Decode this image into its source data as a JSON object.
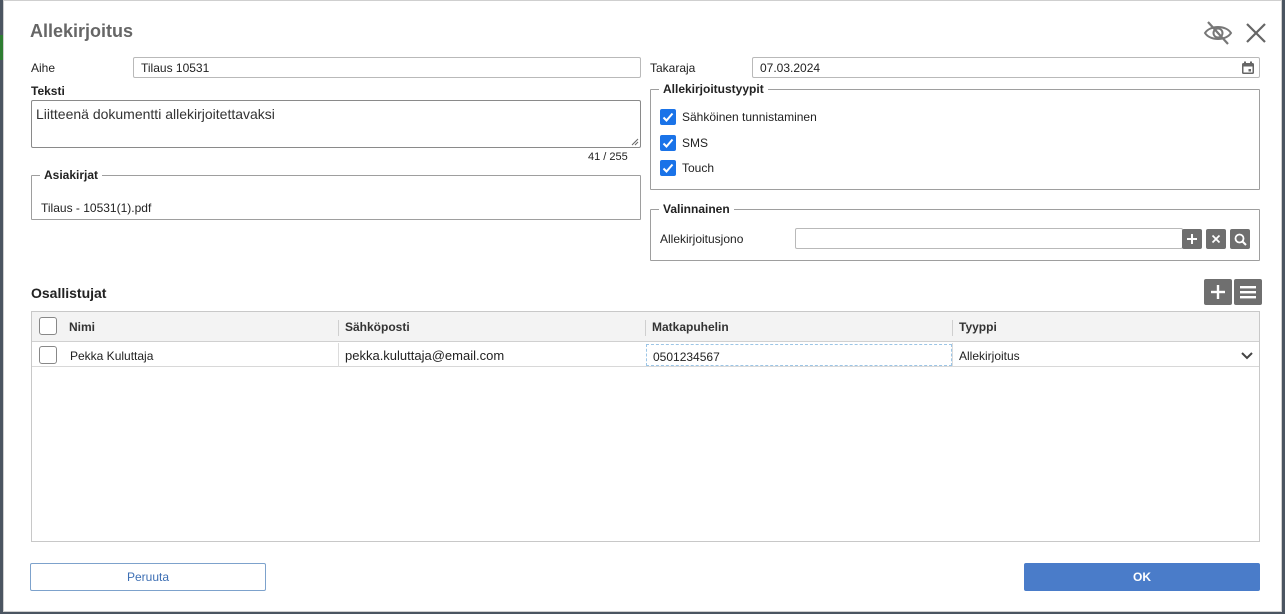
{
  "dialog": {
    "title": "Allekirjoitus"
  },
  "fields": {
    "subject_label": "Aihe",
    "subject_value": "Tilaus 10531",
    "deadline_label": "Takaraja",
    "deadline_value": "07.03.2024",
    "text_label": "Teksti",
    "text_value": "Liitteenä dokumentti allekirjoitettavaksi",
    "text_counter": "41 / 255"
  },
  "documents": {
    "legend": "Asiakirjat",
    "items": [
      "Tilaus - 10531(1).pdf"
    ]
  },
  "signature_types": {
    "legend": "Allekirjoitustyypit",
    "options": [
      {
        "label": "Sähköinen tunnistaminen",
        "checked": true
      },
      {
        "label": "SMS",
        "checked": true
      },
      {
        "label": "Touch",
        "checked": true
      }
    ]
  },
  "optional": {
    "legend": "Valinnainen",
    "queue_label": "Allekirjoitusjono",
    "queue_value": ""
  },
  "participants": {
    "title": "Osallistujat",
    "columns": [
      "Nimi",
      "Sähköposti",
      "Matkapuhelin",
      "Tyyppi"
    ],
    "rows": [
      {
        "name": "Pekka Kuluttaja",
        "email": "pekka.kuluttaja@email.com",
        "phone": "0501234567",
        "type": "Allekirjoitus"
      }
    ]
  },
  "buttons": {
    "cancel": "Peruuta",
    "ok": "OK"
  },
  "colors": {
    "primary": "#4a7cc9",
    "checkbox": "#1a73e8",
    "icon_button": "#6f6f6f"
  },
  "icons": [
    "eye-off-icon",
    "close-icon",
    "calendar-icon",
    "plus-icon",
    "clear-icon",
    "search-icon",
    "menu-icon",
    "chevron-down-icon",
    "check-icon"
  ]
}
